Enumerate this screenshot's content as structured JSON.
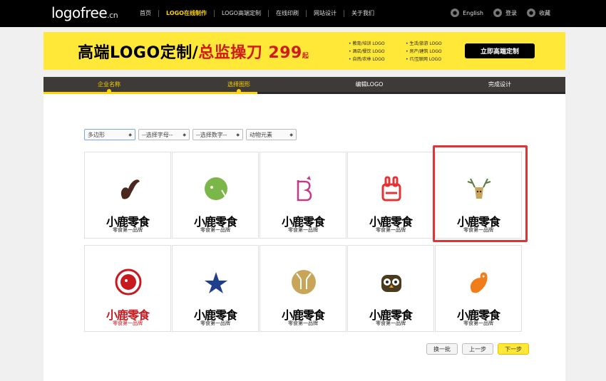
{
  "header": {
    "logo_main": "logofree",
    "logo_tld": ".cn",
    "nav": [
      "首页",
      "LOGO在线制作",
      "LOGO高端定制",
      "在线印刷",
      "网站设计",
      "关于我们"
    ],
    "active_nav_index": 1,
    "lang_label": "English",
    "login_label": "登录",
    "fav_label": "收藏"
  },
  "banner": {
    "headline_a": "高端LOGO定制/",
    "headline_b": "总监操刀",
    "price": "299",
    "price_suffix": "起",
    "categories": [
      "教育/培训 LOGO",
      "生活/旅游 LOGO",
      "酒店/餐饮 LOGO",
      "房产/建筑 LOGO",
      "自然/农林 LOGO",
      "IT/互联网 LOGO"
    ],
    "cta": "立即高端定制",
    "bg_color": "#ffe838"
  },
  "steps": [
    {
      "label": "企业名称",
      "done": true
    },
    {
      "label": "选择图形",
      "done": true
    },
    {
      "label": "编辑LOGO",
      "done": false
    },
    {
      "label": "完成设计",
      "done": false
    }
  ],
  "filters": [
    {
      "value": "多边形"
    },
    {
      "value": "--选择字母--"
    },
    {
      "value": "--选择数字--"
    },
    {
      "value": "动物元素"
    }
  ],
  "tiles": [
    {
      "icon": "squirrel-icon",
      "brand": "小鹿零食",
      "slogan": "零食第一品牌",
      "red": false,
      "color": "#4a2a20"
    },
    {
      "icon": "elephant-icon",
      "brand": "小鹿零食",
      "slogan": "零食第一品牌",
      "red": false,
      "color": "#7ab648"
    },
    {
      "icon": "rabbit-letter-b-icon",
      "brand": "小鹿零食",
      "slogan": "零食第一品牌",
      "red": false,
      "color": "#c53a86"
    },
    {
      "icon": "rabbit-face-icon",
      "brand": "小鹿零食",
      "slogan": "零食第一品牌",
      "red": false,
      "color": "#e23434"
    },
    {
      "icon": "deer-head-icon",
      "brand": "小鹿零食",
      "slogan": "零食第一品牌",
      "red": false,
      "color": "#5a7a3a"
    },
    {
      "icon": "elephant-circle-icon",
      "brand": "小鹿零食",
      "slogan": "零食第一品牌",
      "red": true,
      "color": "#c8191f"
    },
    {
      "icon": "star-wings-icon",
      "brand": "小鹿零食",
      "slogan": "零食第一品牌",
      "red": false,
      "color": "#1f3f8a"
    },
    {
      "icon": "deer-circle-icon",
      "brand": "小鹿零食",
      "slogan": "零食第一品牌",
      "red": false,
      "color": "#c9a55a"
    },
    {
      "icon": "owl-icon",
      "brand": "小鹿零食",
      "slogan": "零食第一品牌",
      "red": false,
      "color": "#4a3a20"
    },
    {
      "icon": "rooster-icon",
      "brand": "小鹿零食",
      "slogan": "零食第一品牌",
      "red": false,
      "color": "#f07d1a"
    }
  ],
  "selected_tile_index": 4,
  "pager": {
    "refresh": "换一批",
    "prev": "上一步",
    "next": "下一步"
  }
}
